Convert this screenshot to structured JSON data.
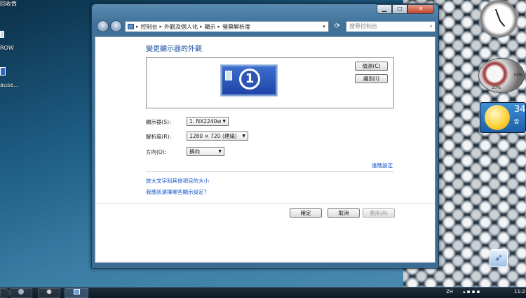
{
  "desktop": {
    "icons": [
      {
        "label": "回收筒"
      },
      {
        "label": "ROW"
      },
      {
        "label": "ause..."
      }
    ]
  },
  "window": {
    "breadcrumbs": [
      "控制台",
      "外觀及個人化",
      "顯示",
      "螢幕解析度"
    ],
    "search_placeholder": "搜尋控制台",
    "heading": "變更顯示器的外觀",
    "monitor_number": "1",
    "detect_label": "偵測(C)",
    "identify_label": "識別(I)",
    "display_label": "顯示器(S):",
    "display_value": "1. NX2240w",
    "resolution_label": "解析度(R):",
    "resolution_value": "1280 × 720 (建議)",
    "orientation_label": "方向(O):",
    "orientation_value": "橫向",
    "advanced_link": "進階設定",
    "link_text_size": "放大文字和其他項目的大小",
    "link_which_settings": "我應該選擇哪些顯示設定?",
    "ok_label": "確定",
    "cancel_label": "取消",
    "apply_label": "套用(A)"
  },
  "caption": {
    "minimize": "▁",
    "maximize": "□",
    "close": "✕"
  },
  "gadgets": {
    "cpu_pct_left": "10%",
    "cpu_pct_right": "32%",
    "weather_temp": "34",
    "weather_cond": "雲"
  },
  "taskbar": {
    "ime": "ZH",
    "clock": "11:2"
  }
}
